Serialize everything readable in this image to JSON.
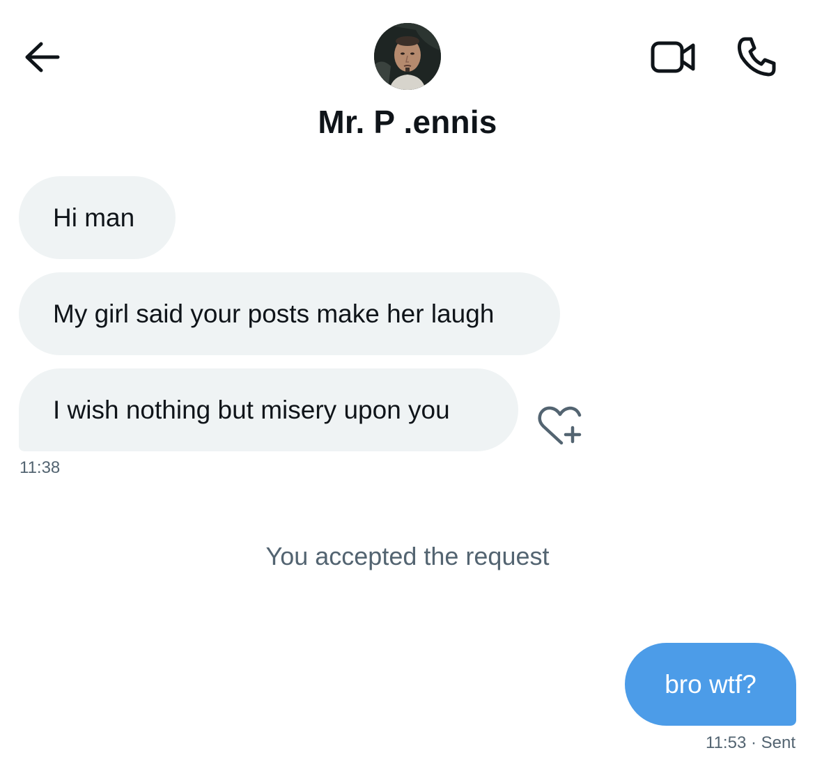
{
  "header": {
    "contact_name": "Mr. P .ennis",
    "icons": {
      "back": "arrow-left-icon",
      "video": "video-call-icon",
      "phone": "phone-call-icon"
    }
  },
  "messages": [
    {
      "direction": "incoming",
      "text": "Hi man"
    },
    {
      "direction": "incoming",
      "text": "My girl said your posts make her laugh"
    },
    {
      "direction": "incoming",
      "text": "I wish nothing but misery upon you"
    }
  ],
  "incoming_timestamp": "11:38",
  "system_message": "You accepted the request",
  "outgoing": {
    "text": "bro wtf?",
    "timestamp": "11:53",
    "status": "Sent",
    "status_line": "11:53 · Sent"
  },
  "colors": {
    "incoming_bubble": "#eff3f4",
    "outgoing_bubble": "#4c9ce8",
    "secondary_text": "#536471",
    "primary_text": "#0f1419"
  }
}
